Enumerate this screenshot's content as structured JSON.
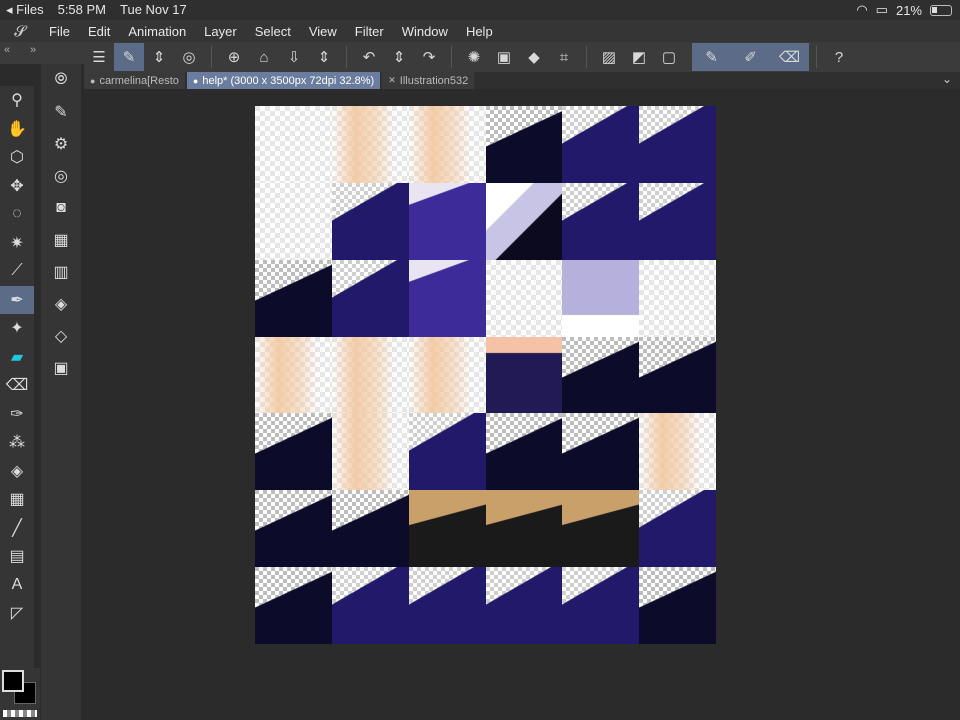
{
  "status_bar": {
    "back_app": "◂ Files",
    "time": "5:58 PM",
    "date": "Tue Nov 17",
    "battery": "21%"
  },
  "menu": {
    "items": [
      "File",
      "Edit",
      "Animation",
      "Layer",
      "Select",
      "View",
      "Filter",
      "Window",
      "Help"
    ]
  },
  "toolbar": {
    "icons": [
      "menu-icon",
      "modify-icon",
      "updown-icon",
      "swirl-icon",
      "new-icon",
      "open-icon",
      "save-icon",
      "updown-icon",
      "undo-icon",
      "updown-icon",
      "redo-icon",
      "spinner-icon",
      "transform-icon",
      "fill-icon",
      "crop-icon",
      "deselect-icon",
      "clear-icon",
      "frame-icon",
      "pen-icon",
      "brush-icon",
      "eraser-icon",
      "help-icon"
    ]
  },
  "tabs": [
    {
      "label": "carmelina[Resto",
      "active": false,
      "mark": "●"
    },
    {
      "label": "help* (3000 x 3500px 72dpi 32.8%)",
      "active": true,
      "mark": "●"
    },
    {
      "label": "Illustration532",
      "active": false,
      "mark": "✕"
    }
  ],
  "tools": [
    "zoom-icon",
    "hand-icon",
    "object-icon",
    "move-icon",
    "lasso-icon",
    "magic-wand-icon",
    "eyedropper-icon",
    "pen-tool-icon",
    "sparkle-icon",
    "marker-icon",
    "eraser-icon",
    "decoration-icon",
    "blend-icon",
    "fill-icon",
    "gradient-icon",
    "line-icon",
    "frame-border-icon",
    "text-icon",
    "correct-line-icon"
  ],
  "sub_tools": [
    "sub-tool-icon",
    "pen-settings-icon",
    "pen-gear-icon",
    "pen-target-icon",
    "circle-layer-icon",
    "grid-icon",
    "film-icon",
    "layer-settings-icon",
    "layers-icon",
    "folder-icon"
  ],
  "colors": {
    "accent": "#5b6b88",
    "cyan": "#1ec8e0",
    "canvas_dark": "#2b2b2b",
    "navy": "#1f1a5a",
    "skin": "#f2c8a0"
  },
  "canvas": {
    "grid": [
      [
        "white",
        "skin",
        "skin",
        "dark",
        "navy",
        "navy"
      ],
      [
        "white",
        "navy",
        "purple",
        "shirt",
        "navy",
        "navy"
      ],
      [
        "dark",
        "navy",
        "purple",
        "white",
        "lilac",
        "white"
      ],
      [
        "skin",
        "skin",
        "skin",
        "figure",
        "dark",
        "dark"
      ],
      [
        "dark",
        "skin",
        "navy",
        "dark",
        "dark",
        "skin"
      ],
      [
        "dark",
        "dark",
        "tan",
        "tan",
        "tan",
        "navy"
      ],
      [
        "dark",
        "navy",
        "navy",
        "navy",
        "navy",
        "dark"
      ]
    ]
  }
}
